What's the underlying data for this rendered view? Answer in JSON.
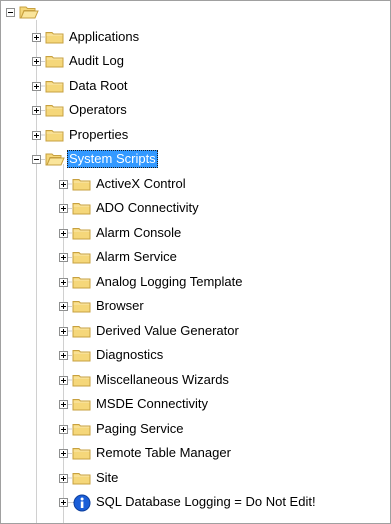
{
  "tree": {
    "root": {
      "expanded": true,
      "icon": "folder-open-icon"
    },
    "level1": [
      {
        "label": "Applications",
        "expanded": false,
        "icon": "folder-icon"
      },
      {
        "label": "Audit Log",
        "expanded": false,
        "icon": "folder-icon"
      },
      {
        "label": "Data Root",
        "expanded": false,
        "icon": "folder-icon"
      },
      {
        "label": "Operators",
        "expanded": false,
        "icon": "folder-icon"
      },
      {
        "label": "Properties",
        "expanded": false,
        "icon": "folder-icon"
      },
      {
        "label": "System Scripts",
        "expanded": true,
        "selected": true,
        "icon": "folder-open-icon"
      }
    ],
    "system_scripts_children": [
      {
        "label": "ActiveX Control",
        "icon": "folder-icon"
      },
      {
        "label": "ADO Connectivity",
        "icon": "folder-icon"
      },
      {
        "label": "Alarm Console",
        "icon": "folder-icon"
      },
      {
        "label": "Alarm Service",
        "icon": "folder-icon"
      },
      {
        "label": "Analog Logging Template",
        "icon": "folder-icon"
      },
      {
        "label": "Browser",
        "icon": "folder-icon"
      },
      {
        "label": "Derived Value Generator",
        "icon": "folder-icon"
      },
      {
        "label": "Diagnostics",
        "icon": "folder-icon"
      },
      {
        "label": "Miscellaneous Wizards",
        "icon": "folder-icon"
      },
      {
        "label": "MSDE Connectivity",
        "icon": "folder-icon"
      },
      {
        "label": "Paging Service",
        "icon": "folder-icon"
      },
      {
        "label": "Remote Table Manager",
        "icon": "folder-icon"
      },
      {
        "label": "Site",
        "icon": "folder-icon"
      },
      {
        "label": "SQL Database Logging = Do Not Edit!",
        "icon": "info-icon"
      }
    ]
  },
  "colors": {
    "selection": "#3399ff",
    "folder_fill": "#f5d77a",
    "folder_edge": "#c7a040",
    "info_blue": "#1a5ed8",
    "tree_line": "#a0a0a0"
  }
}
